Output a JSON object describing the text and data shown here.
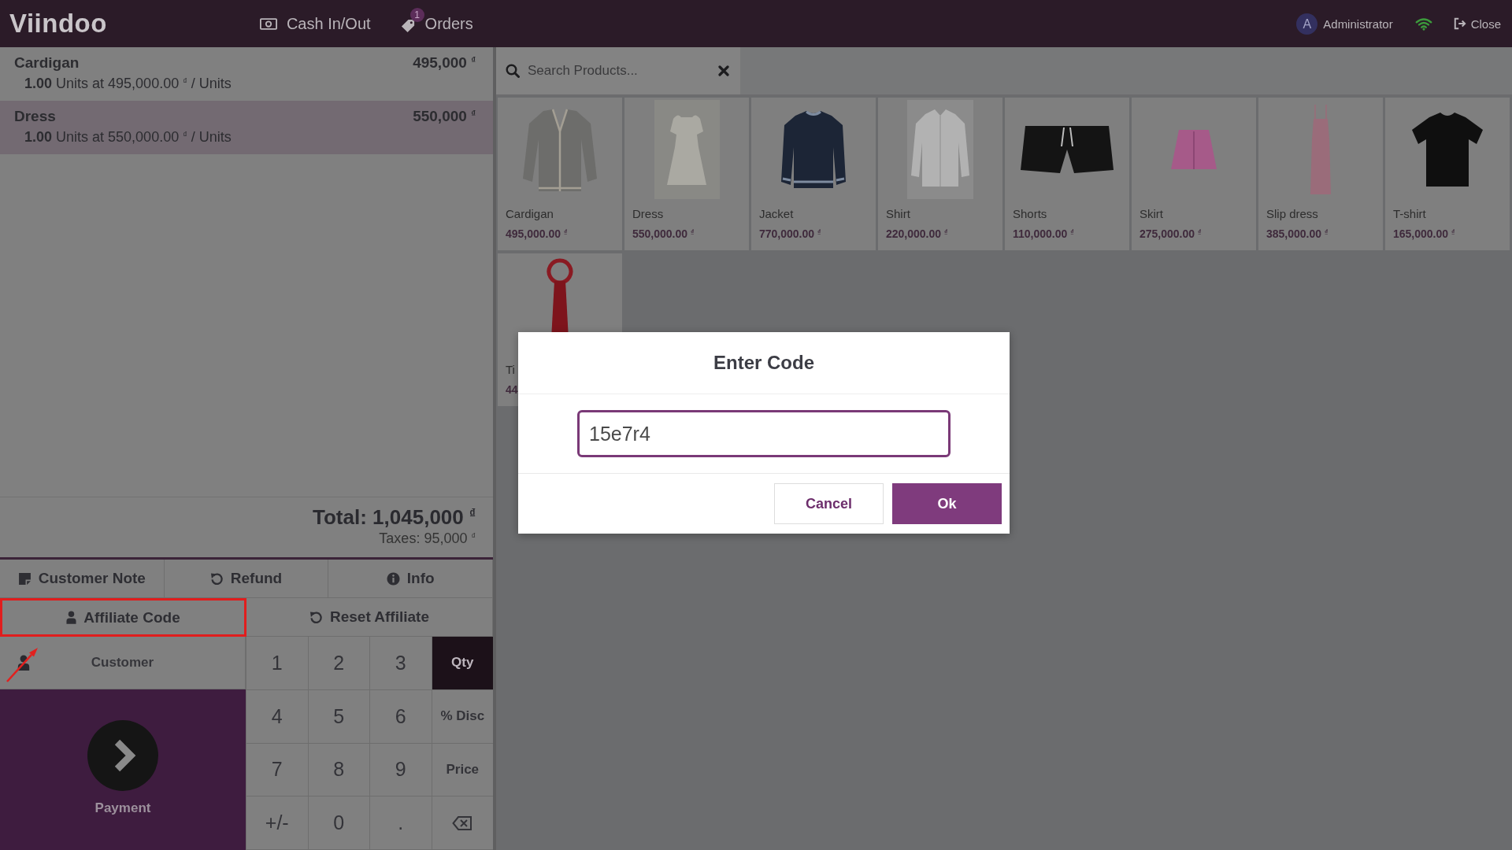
{
  "header": {
    "logo": "Viindoo",
    "menu": [
      {
        "label": "Cash In/Out",
        "kind": "cash"
      },
      {
        "label": "Orders",
        "kind": "orders",
        "badge": "1"
      }
    ],
    "user": {
      "initial": "A",
      "name": "Administrator"
    },
    "close": "Close"
  },
  "order_lines": [
    {
      "product": "Cardigan",
      "price": "495,000 $^{₫}$",
      "detail": "**1.00** Units at 495,000.00 $^{₫}$ / Units",
      "selected": false
    },
    {
      "product": "Dress",
      "price": "550,000 $^{₫}$",
      "detail": "**1.00** Units at 550,000.00 $^{₫}$ / Units",
      "selected": true
    }
  ],
  "totals": {
    "total": "Total: 1,045,000 $^{₫}$",
    "taxes": "Taxes: 95,000 $^{₫}$"
  },
  "action_rows": [
    [
      {
        "label": "Customer Note",
        "kind": "note",
        "highlighted": false
      },
      {
        "label": "Refund",
        "kind": "refund",
        "highlighted": false
      },
      {
        "label": "Info",
        "kind": "info",
        "highlighted": false
      }
    ],
    [
      {
        "label": "Affiliate Code",
        "kind": "affiliate",
        "highlighted": true
      },
      {
        "label": "Reset Affiliate",
        "kind": "reset",
        "highlighted": false
      }
    ]
  ],
  "customer_button": {
    "label": "Customer"
  },
  "payment_button": {
    "label": "Payment"
  },
  "numpad": [
    {
      "label": "1",
      "kind": "digit",
      "selected": false
    },
    {
      "label": "2",
      "kind": "digit",
      "selected": false
    },
    {
      "label": "3",
      "kind": "digit",
      "selected": false
    },
    {
      "label": "Qty",
      "kind": "mode",
      "selected": true
    },
    {
      "label": "4",
      "kind": "digit",
      "selected": false
    },
    {
      "label": "5",
      "kind": "digit",
      "selected": false
    },
    {
      "label": "6",
      "kind": "digit",
      "selected": false
    },
    {
      "label": "% Disc",
      "kind": "mode",
      "selected": false
    },
    {
      "label": "7",
      "kind": "digit",
      "selected": false
    },
    {
      "label": "8",
      "kind": "digit",
      "selected": false
    },
    {
      "label": "9",
      "kind": "digit",
      "selected": false
    },
    {
      "label": "Price",
      "kind": "mode",
      "selected": false
    },
    {
      "label": "+/-",
      "kind": "digit",
      "selected": false
    },
    {
      "label": "0",
      "kind": "digit",
      "selected": false
    },
    {
      "label": ".",
      "kind": "digit",
      "selected": false
    },
    {
      "kind": "backspace",
      "selected": false
    }
  ],
  "search": {
    "placeholder": "Search Products..."
  },
  "products": [
    {
      "name": "Cardigan",
      "price": "495,000.00 $^{₫}$",
      "kind": "cardigan"
    },
    {
      "name": "Dress",
      "price": "550,000.00 $^{₫}$",
      "kind": "dress"
    },
    {
      "name": "Jacket",
      "price": "770,000.00 $^{₫}$",
      "kind": "jacket"
    },
    {
      "name": "Shirt",
      "price": "220,000.00 $^{₫}$",
      "kind": "shirt"
    },
    {
      "name": "Shorts",
      "price": "110,000.00 $^{₫}$",
      "kind": "shorts"
    },
    {
      "name": "Skirt",
      "price": "275,000.00 $^{₫}$",
      "kind": "skirt"
    },
    {
      "name": "Slip dress",
      "price": "385,000.00 $^{₫}$",
      "kind": "slipdress"
    },
    {
      "name": "T-shirt",
      "price": "165,000.00 $^{₫}$",
      "kind": "tshirt"
    },
    {
      "name": "Ti",
      "price": "44",
      "kind": "tie"
    }
  ],
  "dialog": {
    "title": "Enter Code",
    "value": "15e7r4",
    "buttons": [
      {
        "label": "Cancel",
        "kind": "secondary"
      },
      {
        "label": "Ok",
        "kind": "primary"
      }
    ]
  }
}
